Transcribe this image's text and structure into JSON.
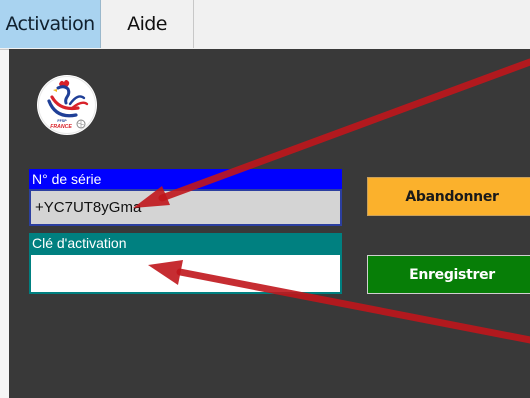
{
  "tabs": [
    {
      "label": "Activation",
      "active": true
    },
    {
      "label": "Aide",
      "active": false
    }
  ],
  "logo": {
    "caption_top": "FFSP",
    "caption_bottom": "FRANCE"
  },
  "form": {
    "serial": {
      "label": "N° de série",
      "value": "+YC7UT8yGma"
    },
    "activation_key": {
      "label": "Clé d'activation",
      "value": ""
    }
  },
  "buttons": {
    "abandon": "Abandonner",
    "save": "Enregistrer"
  },
  "colors": {
    "active_tab": "#a9d3f0",
    "panel_background": "#393939",
    "serial_label_background": "#0000ff",
    "key_label_background": "#008080",
    "abandon_button": "#fbb12c",
    "save_button": "#077e07",
    "annotation_arrow": "#c0161c"
  },
  "icons": {
    "logo": "rooster-logo",
    "annotation": "red-pointer-arrow"
  }
}
